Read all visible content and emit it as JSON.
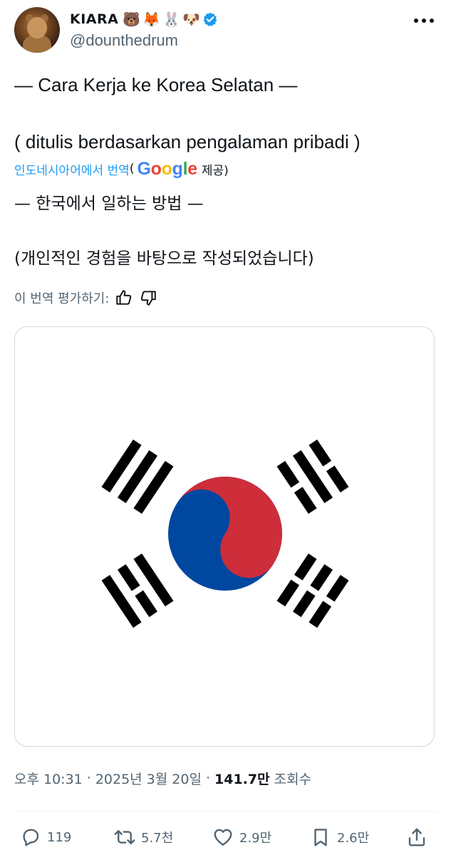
{
  "header": {
    "display_name": "KIARA",
    "emojis": [
      "🐻",
      "🦊",
      "🐰",
      "🐶"
    ],
    "handle": "@dounthedrum",
    "verified_icon": "verified-badge-icon",
    "more_icon": "more-icon"
  },
  "tweet": {
    "line1": "— Cara Kerja ke Korea Selatan —",
    "line2": "( ditulis berdasarkan pengalaman pribadi )"
  },
  "translation": {
    "link_label": "인도네시아어에서 번역",
    "open_paren": "(",
    "google": [
      "G",
      "o",
      "o",
      "g",
      "l",
      "e"
    ],
    "provided_label": "제공)",
    "line1": "— 한국에서 일하는 방법 —",
    "line2": "(개인적인 경험을 바탕으로 작성되었습니다)"
  },
  "rate": {
    "label": "이 번역 평가하기:",
    "thumbs_up_icon": "thumbs-up-icon",
    "thumbs_down_icon": "thumbs-down-icon"
  },
  "media": {
    "image": "south-korea-flag",
    "colors": {
      "red": "#cd2e3a",
      "blue": "#0047a0",
      "black": "#000000"
    }
  },
  "meta": {
    "time": "오후 10:31",
    "dot1": "·",
    "date": "2025년 3월 20일",
    "dot2": "·",
    "views_count": "141.7만",
    "views_label": "조회수"
  },
  "actions": {
    "replies": "119",
    "reposts": "5.7천",
    "likes": "2.9만",
    "bookmarks": "2.6만"
  },
  "colors": {
    "text": "#0f1419",
    "secondary": "#536471",
    "link": "#1d9bf0",
    "verified": "#1d9bf0",
    "border": "#cfd9de"
  }
}
